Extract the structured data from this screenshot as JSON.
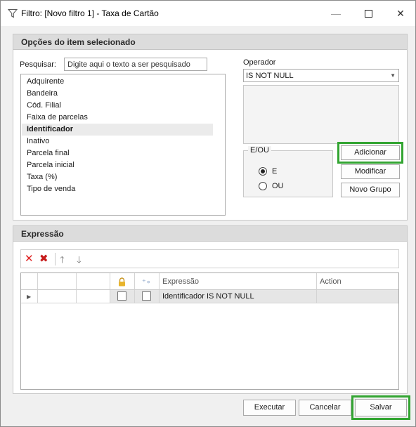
{
  "window": {
    "title": "Filtro: [Novo filtro 1] - Taxa de Cartão",
    "icon": "funnel-icon",
    "controls": {
      "minimize": "—",
      "close": "✕"
    }
  },
  "options": {
    "header": "Opções do item selecionado",
    "search_label": "Pesquisar:",
    "search_value": "Digite aqui o texto a ser pesquisado",
    "fields": [
      "Adquirente",
      "Bandeira",
      "Cód. Filial",
      "Faixa de parcelas",
      "Identificador",
      "Inativo",
      "Parcela final",
      "Parcela inicial",
      "Taxa (%)",
      "Tipo de venda"
    ],
    "selected_field": "Identificador",
    "operator_label": "Operador",
    "operator_value": "IS NOT NULL",
    "logic_label": "E/OU",
    "logic_options": [
      "E",
      "OU"
    ],
    "logic_selected": "E",
    "buttons": {
      "add": "Adicionar",
      "modify": "Modificar",
      "new_group": "Novo Grupo"
    }
  },
  "expression": {
    "header": "Expressão",
    "toolbar": [
      "delete-icon",
      "delete-all-icon",
      "move-up-icon",
      "move-down-icon"
    ],
    "columns": [
      "",
      "",
      "",
      "lock-icon",
      "link-icon",
      "Expressão",
      "Action"
    ],
    "rows": [
      {
        "expression": "Identificador IS NOT NULL",
        "action": ""
      }
    ]
  },
  "footer": {
    "execute": "Executar",
    "cancel": "Cancelar",
    "save": "Salvar"
  },
  "colors": {
    "highlight": "#33a532",
    "header_bg": "#dcdcdc",
    "selected_row": "#e6e6e6"
  }
}
